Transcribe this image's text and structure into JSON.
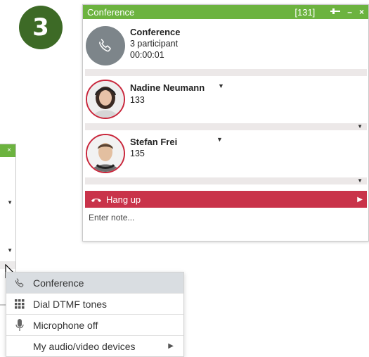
{
  "badge": {
    "number": "3"
  },
  "conference": {
    "title": "Conference",
    "ext": "[131]",
    "header": {
      "name": "Conference",
      "participants": "3 participant",
      "duration": "00:00:01"
    },
    "participants": [
      {
        "name": "Nadine Neumann",
        "number": "133"
      },
      {
        "name": "Stefan Frei",
        "number": "135"
      }
    ],
    "hangup_label": "Hang up",
    "note_placeholder": "Enter note..."
  },
  "back_window": {
    "close": "×"
  },
  "menu": {
    "items": [
      {
        "label": "Conference",
        "icon": "phone-icon"
      },
      {
        "label": "Dial DTMF tones",
        "icon": "dialpad-icon"
      },
      {
        "label": "Microphone off",
        "icon": "microphone-icon"
      },
      {
        "label": "My audio/video devices",
        "icon": "none",
        "submenu": true
      }
    ]
  },
  "colors": {
    "titlebar": "#6cb33f",
    "hangup": "#c9334a",
    "badge": "#3d6a26",
    "avatar_ring": "#c9263b"
  }
}
